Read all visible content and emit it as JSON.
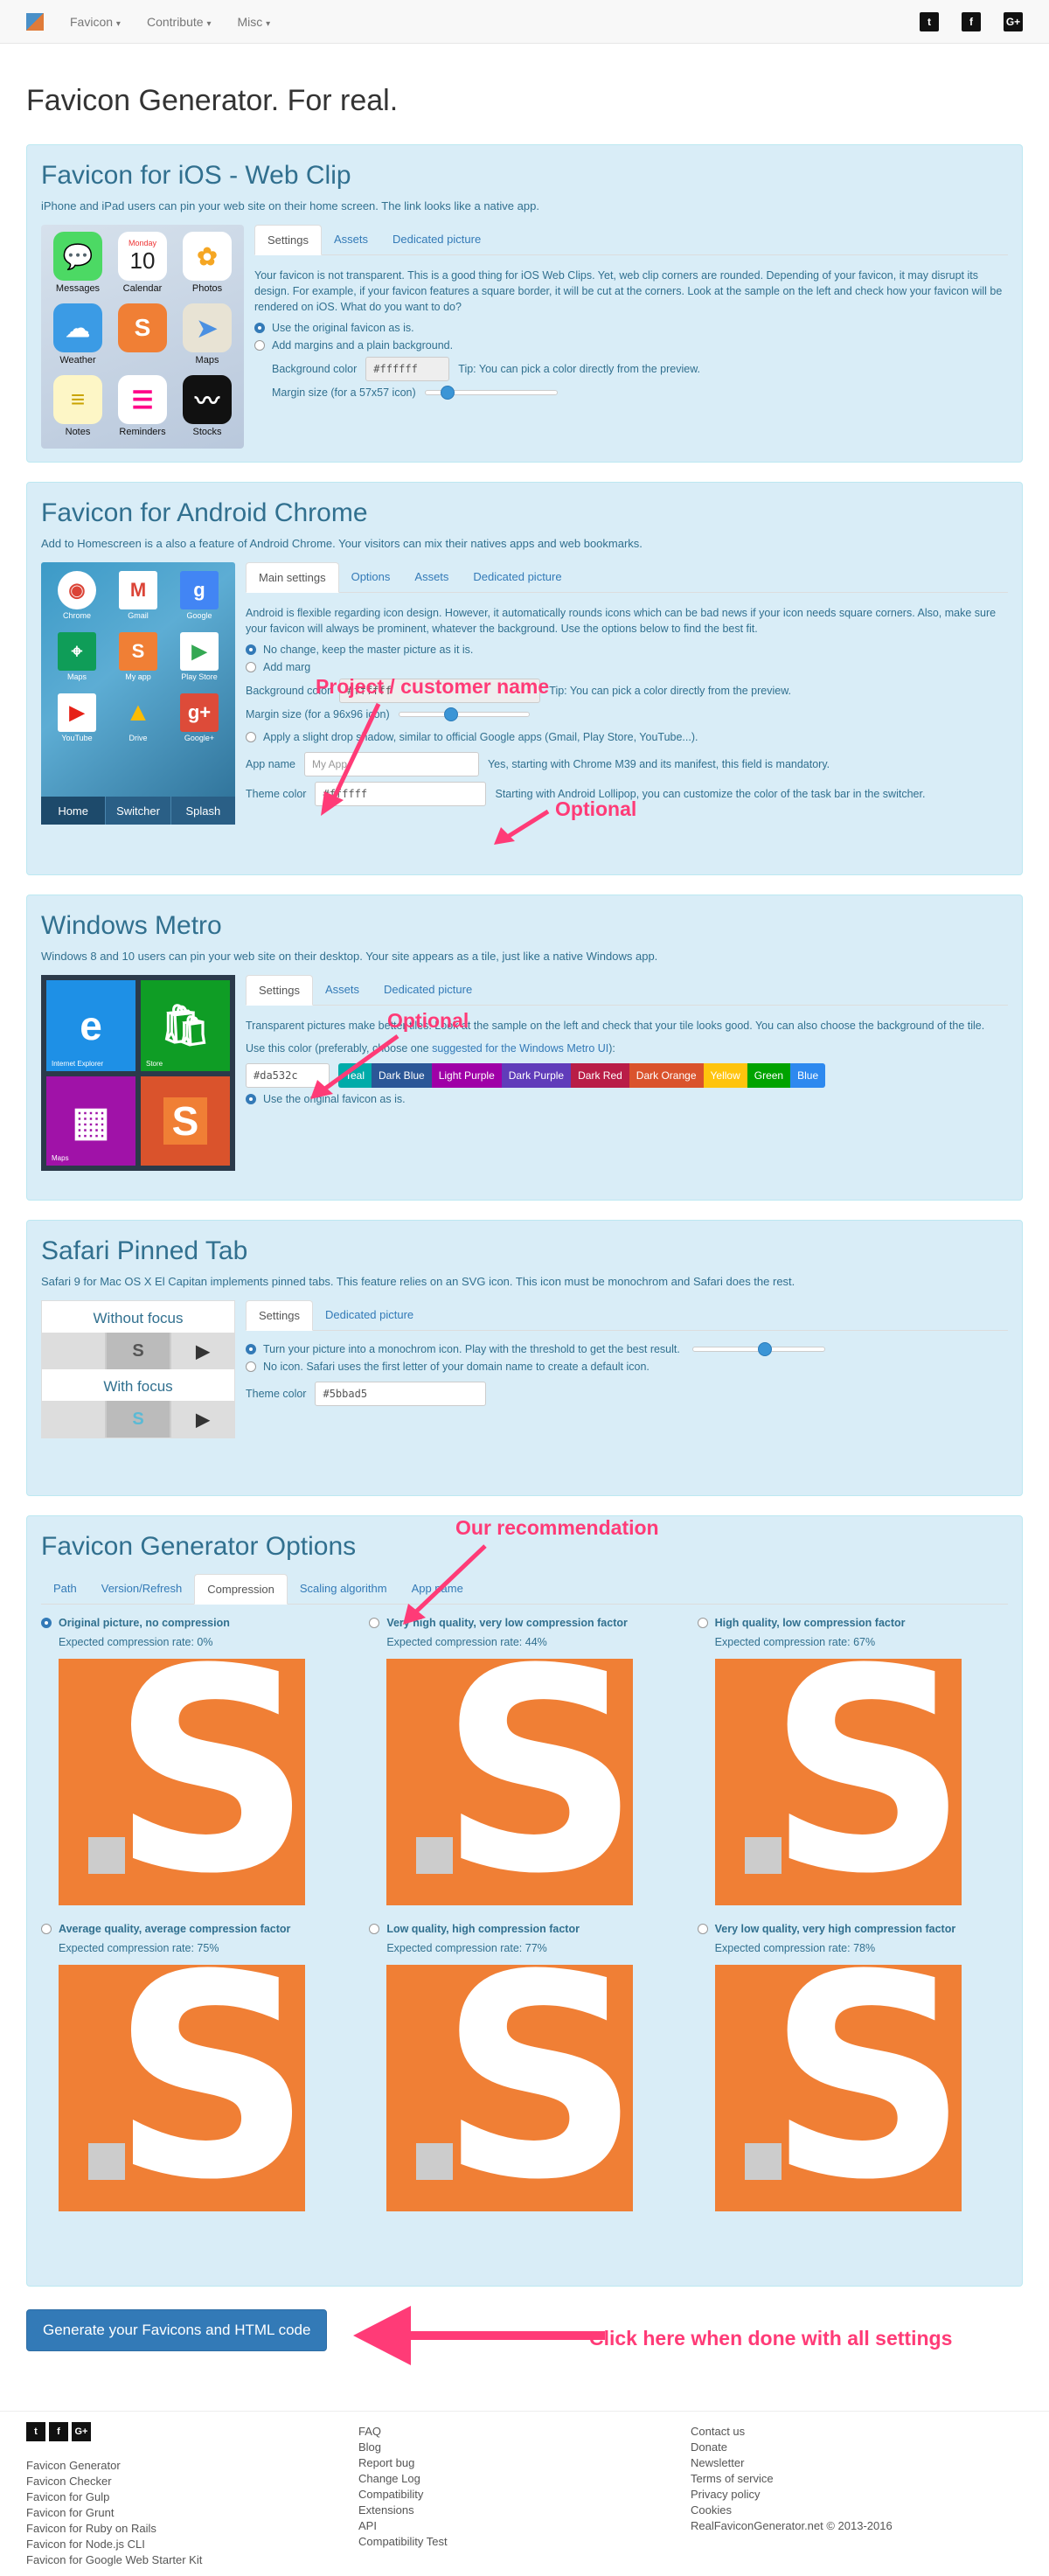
{
  "nav": {
    "items": [
      {
        "label": "Favicon",
        "icon": "caret-down-icon"
      },
      {
        "label": "Contribute",
        "icon": "caret-down-icon"
      },
      {
        "label": "Misc",
        "icon": "caret-down-icon"
      }
    ],
    "social": [
      "twitter-icon",
      "facebook-icon",
      "google-plus-icon"
    ]
  },
  "page_title": "Favicon Generator. For real.",
  "ios": {
    "title": "Favicon for iOS - Web Clip",
    "desc": "iPhone and iPad users can pin your web site on their home screen. The link looks like a native app.",
    "tabs": [
      "Settings",
      "Assets",
      "Dedicated picture"
    ],
    "para": "Your favicon is not transparent. This is a good thing for iOS Web Clips. Yet, web clip corners are rounded. Depending of your favicon, it may disrupt its design. For example, if your favicon features a square border, it will be cut at the corners. Look at the sample on the left and check how your favicon will be rendered on iOS. What do you want to do?",
    "opt1": "Use the original favicon as is.",
    "opt2": "Add margins and a plain background.",
    "bg_label": "Background color",
    "bg_value": "#ffffff",
    "bg_tip": "Tip: You can pick a color directly from the preview.",
    "margin_label": "Margin size (for a 57x57 icon)",
    "margin_level": 0.17,
    "apps": [
      "Messages",
      "Calendar",
      "Photos",
      "Weather",
      "",
      "Maps",
      "Notes",
      "Reminders",
      "Stocks"
    ],
    "calendar_day": "Monday",
    "calendar_date": "10"
  },
  "android": {
    "title": "Favicon for Android Chrome",
    "desc": "Add to Homescreen is a also a feature of Android Chrome. Your visitors can mix their natives apps and web bookmarks.",
    "tabs": [
      "Main settings",
      "Options",
      "Assets",
      "Dedicated picture"
    ],
    "para": "Android is flexible regarding icon design. However, it automatically rounds icons which can be bad news if your icon needs square corners. Also, make sure your favicon will always be prominent, whatever the background. Use the options below to find the best fit.",
    "opt1": "No change, keep the master picture as it is.",
    "opt2": "Add marg",
    "bg_label": "Background color",
    "bg_value": "#ffffff",
    "bg_tip": "Tip: You can pick a color directly from the preview.",
    "margin_label": "Margin size (for a 96x96 icon)",
    "margin_level": 0.4,
    "opt3": "Apply a slight drop shadow, similar to official Google apps (Gmail, Play Store, YouTube...).",
    "app_name_label": "App name",
    "app_name_placeholder": "My App",
    "app_name_help": "Yes, starting with Chrome M39 and its manifest, this field is mandatory.",
    "theme_label": "Theme color",
    "theme_value": "#ffffff",
    "theme_help": "Starting with Android Lollipop, you can customize the color of the task bar in the switcher.",
    "apps": [
      "Chrome",
      "Gmail",
      "Google",
      "Maps",
      "My app",
      "Play Store",
      "YouTube",
      "Drive",
      "Google+"
    ],
    "bar": [
      "Home",
      "Switcher",
      "Splash"
    ]
  },
  "windows": {
    "title": "Windows Metro",
    "desc": "Windows 8 and 10 users can pin your web site on their desktop. Your site appears as a tile, just like a native Windows app.",
    "tabs": [
      "Settings",
      "Assets",
      "Dedicated picture"
    ],
    "para": "Transparent pictures make better tiles. Look at the sample on the left and check that your tile looks good. You can also choose the background of the tile.",
    "color_label_a": "Use this color (preferably, choose one ",
    "color_label_link": "suggested for the Windows Metro UI",
    "color_label_b": "):",
    "color_value": "#da532c",
    "colors": [
      {
        "name": "Teal",
        "hex": "#00aba9"
      },
      {
        "name": "Dark Blue",
        "hex": "#2b5797"
      },
      {
        "name": "Light Purple",
        "hex": "#9f00a7"
      },
      {
        "name": "Dark Purple",
        "hex": "#603cba"
      },
      {
        "name": "Dark Red",
        "hex": "#b91d47"
      },
      {
        "name": "Dark Orange",
        "hex": "#da532c"
      },
      {
        "name": "Yellow",
        "hex": "#ffc40d"
      },
      {
        "name": "Green",
        "hex": "#00a300"
      },
      {
        "name": "Blue",
        "hex": "#2d89ef"
      }
    ],
    "opt1": "Use the original favicon as is.",
    "tiles": [
      "Internet Explorer",
      "Store",
      "Maps",
      ""
    ]
  },
  "safari": {
    "title": "Safari Pinned Tab",
    "desc": "Safari 9 for Mac OS X El Capitan implements pinned tabs. This feature relies on an SVG icon. This icon must be monochrom and Safari does the rest.",
    "tabs": [
      "Settings",
      "Dedicated picture"
    ],
    "opt1": "Turn your picture into a monochrom icon. Play with the threshold to get the best result.",
    "threshold_level": 0.55,
    "opt2": "No icon. Safari uses the first letter of your domain name to create a default icon.",
    "theme_label": "Theme color",
    "theme_value": "#5bbad5",
    "without_focus": "Without focus",
    "with_focus": "With focus"
  },
  "options": {
    "title": "Favicon Generator Options",
    "tabs": [
      "Path",
      "Version/Refresh",
      "Compression",
      "Scaling algorithm",
      "App name"
    ],
    "items": [
      {
        "label": "Original picture, no compression",
        "rate": "Expected compression rate: 0%"
      },
      {
        "label": "Very high quality, very low compression factor",
        "rate": "Expected compression rate: 44%"
      },
      {
        "label": "High quality, low compression factor",
        "rate": "Expected compression rate: 67%"
      },
      {
        "label": "Average quality, average compression factor",
        "rate": "Expected compression rate: 75%"
      },
      {
        "label": "Low quality, high compression factor",
        "rate": "Expected compression rate: 77%"
      },
      {
        "label": "Very low quality, very high compression factor",
        "rate": "Expected compression rate: 78%"
      }
    ],
    "preview_letter": "S"
  },
  "generate_button": "Generate your Favicons and HTML code",
  "annotations": {
    "project_name": "Project / customer name",
    "optional1": "Optional",
    "optional2": "Optional",
    "recommendation": "Our recommendation",
    "click_here": "Click here when done with all settings"
  },
  "footer": {
    "col1": [
      "Favicon Generator",
      "Favicon Checker",
      "Favicon for Gulp",
      "Favicon for Grunt",
      "Favicon for Ruby on Rails",
      "Favicon for Node.js CLI",
      "Favicon for Google Web Starter Kit"
    ],
    "col2": [
      "FAQ",
      "Blog",
      "Report bug",
      "Change Log",
      "Compatibility",
      "Extensions",
      "API",
      "Compatibility Test"
    ],
    "col3": [
      "Contact us",
      "Donate",
      "Newsletter",
      "Terms of service",
      "Privacy policy",
      "Cookies",
      "RealFaviconGenerator.net © 2013-2016"
    ]
  },
  "colors": {
    "accent": "#337ab7",
    "panel": "#d9edf7",
    "panel_text": "#31708f",
    "favicon_orange": "#f07f35",
    "annotation": "#ff3b77"
  }
}
